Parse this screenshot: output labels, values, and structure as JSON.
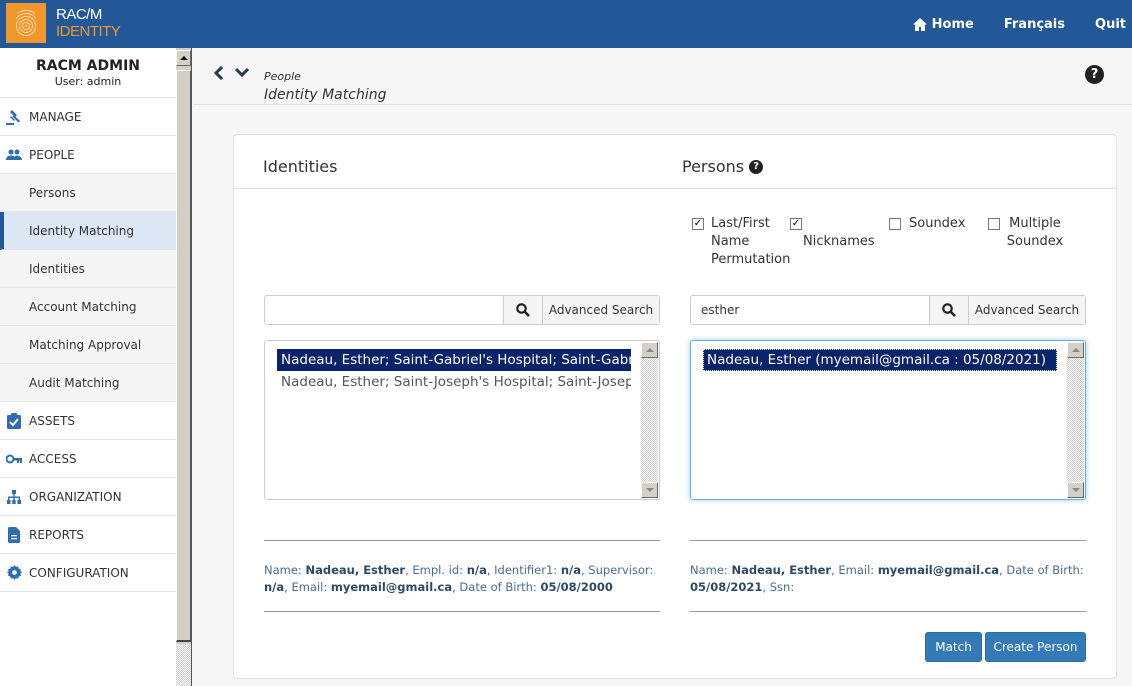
{
  "app": {
    "logo_line1": "RAC/M",
    "logo_line2": "IDENTITY"
  },
  "topnav": {
    "home": "Home",
    "language": "Français",
    "quit": "Quit"
  },
  "user": {
    "name": "RACM ADMIN",
    "subtitle": "User: admin"
  },
  "sidebar": {
    "items": [
      {
        "label": "MANAGE",
        "icon": "gavel-icon"
      },
      {
        "label": "PEOPLE",
        "icon": "people-icon"
      },
      {
        "label": "ASSETS",
        "icon": "clipboard-check-icon"
      },
      {
        "label": "ACCESS",
        "icon": "key-icon"
      },
      {
        "label": "ORGANIZATION",
        "icon": "sitemap-icon"
      },
      {
        "label": "REPORTS",
        "icon": "document-icon"
      },
      {
        "label": "CONFIGURATION",
        "icon": "gear-icon"
      }
    ],
    "people_sub": [
      {
        "label": "Persons"
      },
      {
        "label": "Identity Matching",
        "active": true
      },
      {
        "label": "Identities"
      },
      {
        "label": "Account Matching"
      },
      {
        "label": "Matching Approval"
      },
      {
        "label": "Audit Matching"
      }
    ]
  },
  "breadcrumb": {
    "parent": "People",
    "current": "Identity Matching"
  },
  "identities": {
    "title": "Identities",
    "search_value": "",
    "advanced_search": "Advanced Search",
    "list": [
      {
        "text": "Nadeau, Esther; Saint-Gabriel's Hospital; Saint-Gabriel's Hospital",
        "selected": true
      },
      {
        "text": "Nadeau, Esther; Saint-Joseph's Hospital; Saint-Joseph's Hospital",
        "selected": false
      }
    ],
    "detail": {
      "name_label": "Name: ",
      "name": "Nadeau, Esther",
      "empl_label": ", Empl. id: ",
      "empl": "n/a",
      "id1_label": ", Identifier1: ",
      "id1": "n/a",
      "sup_label": ", Supervisor: ",
      "sup": "n/a",
      "email_label": ", Email: ",
      "email": "myemail@gmail.ca",
      "dob_label": ", Date of Birth: ",
      "dob": "05/08/2000"
    }
  },
  "persons": {
    "title": "Persons",
    "options": [
      {
        "label": "Last/First Name Permutation",
        "checked": true
      },
      {
        "label": "Nicknames",
        "checked": true
      },
      {
        "label": "Soundex",
        "checked": false
      },
      {
        "label": "Multiple Soundex",
        "checked": false
      }
    ],
    "search_value": "esther",
    "advanced_search": "Advanced Search",
    "list": [
      {
        "text": "Nadeau, Esther (myemail@gmail.ca : 05/08/2021)",
        "selected": true
      }
    ],
    "detail": {
      "name_label": "Name: ",
      "name": "Nadeau, Esther",
      "email_label": ", Email: ",
      "email": "myemail@gmail.ca",
      "dob_label": ", Date of Birth: ",
      "dob": "05/08/2021",
      "ssn_label": ", Ssn:"
    }
  },
  "actions": {
    "match": "Match",
    "create_person": "Create Person"
  },
  "colors": {
    "brand": "#225897",
    "accent": "#f0962b",
    "primary_button": "#337ab7",
    "selection": "#0a246a"
  }
}
